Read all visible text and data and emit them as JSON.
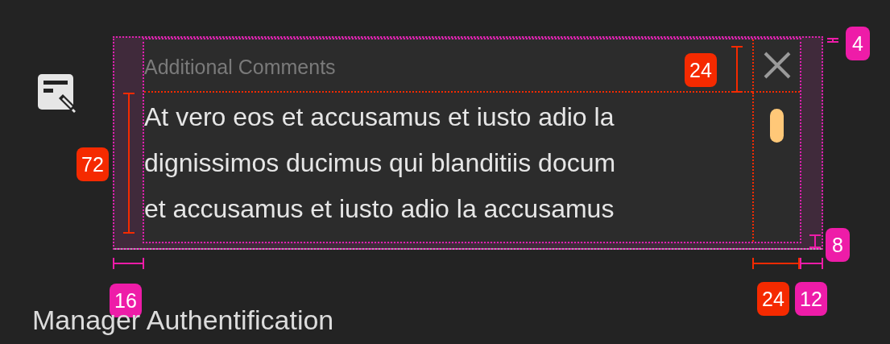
{
  "field": {
    "label": "Additional Comments",
    "value_lines": [
      "At vero eos et accusamus et iusto adio la",
      "dignissimos ducimus qui blanditiis docum",
      "et accusamus et iusto adio la accusamus"
    ],
    "clear_button": true,
    "scrollbar": true
  },
  "annotations": [
    {
      "value": "4",
      "color": "#ee1ca8"
    },
    {
      "value": "24",
      "color": "#f52a00"
    },
    {
      "value": "72",
      "color": "#f52a00"
    },
    {
      "value": "8",
      "color": "#ee1ca8"
    },
    {
      "value": "16",
      "color": "#ee1ca8"
    },
    {
      "value": "24",
      "color": "#f52a00"
    },
    {
      "value": "12",
      "color": "#ee1ca8"
    }
  ],
  "section_title": "Manager Authentification"
}
